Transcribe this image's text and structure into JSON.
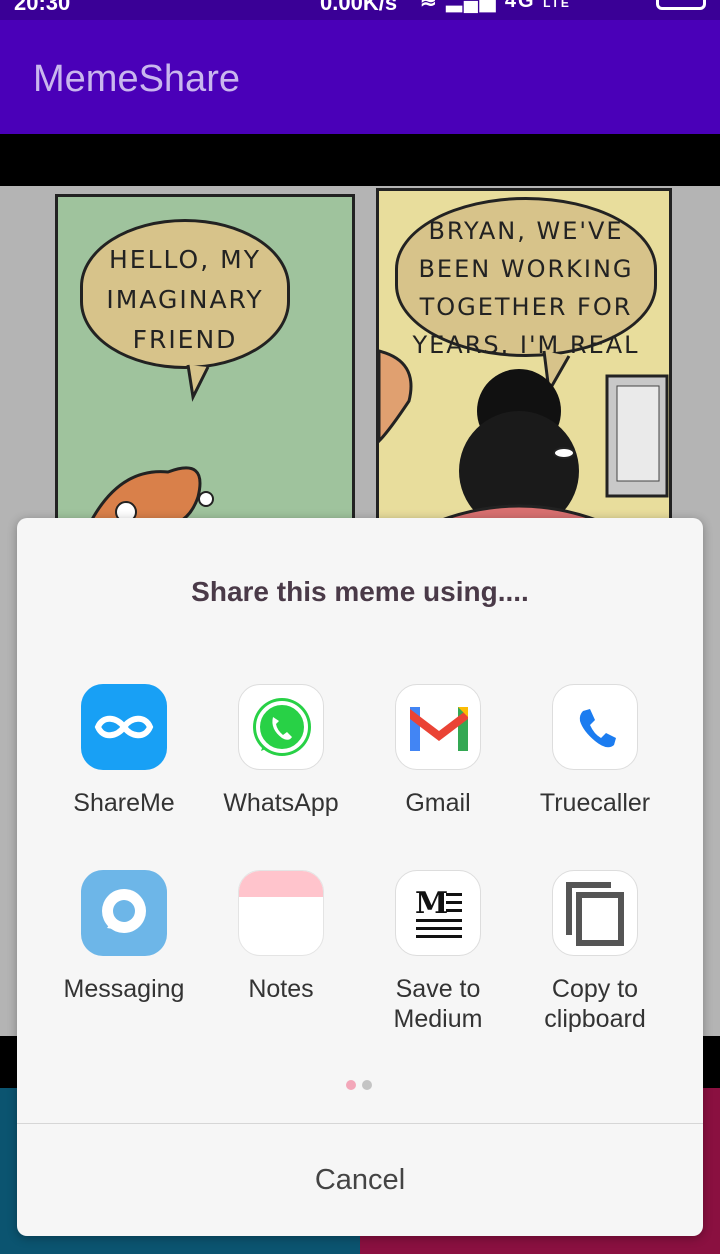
{
  "status_bar": {
    "time": "20:30",
    "speed": "0.00K/s",
    "network": "4G",
    "lte": "LTE"
  },
  "app_bar": {
    "title": "MemeShare"
  },
  "meme": {
    "panel1_text": "Hello, my imaginary friend",
    "panel2_text": "Bryan, we've been working together for years. I'm real"
  },
  "share_sheet": {
    "title": "Share this meme using....",
    "apps_row1": [
      {
        "label": "ShareMe",
        "icon": "shareme-icon"
      },
      {
        "label": "WhatsApp",
        "icon": "whatsapp-icon"
      },
      {
        "label": "Gmail",
        "icon": "gmail-icon"
      },
      {
        "label": "Truecaller",
        "icon": "truecaller-icon"
      }
    ],
    "apps_row2": [
      {
        "label": "Messaging",
        "icon": "messaging-icon"
      },
      {
        "label": "Notes",
        "icon": "notes-icon"
      },
      {
        "label": "Save to Medium",
        "icon": "medium-icon"
      },
      {
        "label": "Copy to clipboard",
        "icon": "copy-icon"
      }
    ],
    "pages": {
      "count": 2,
      "current": 1
    },
    "cancel_label": "Cancel"
  },
  "colors": {
    "app_bar": "#4a00b8",
    "status_bar": "#3a0096",
    "share_button_left": "#0b5470",
    "share_button_right": "#8a1040",
    "page_dot_active": "#f3a7b9",
    "page_dot_inactive": "#c4c4c4"
  }
}
